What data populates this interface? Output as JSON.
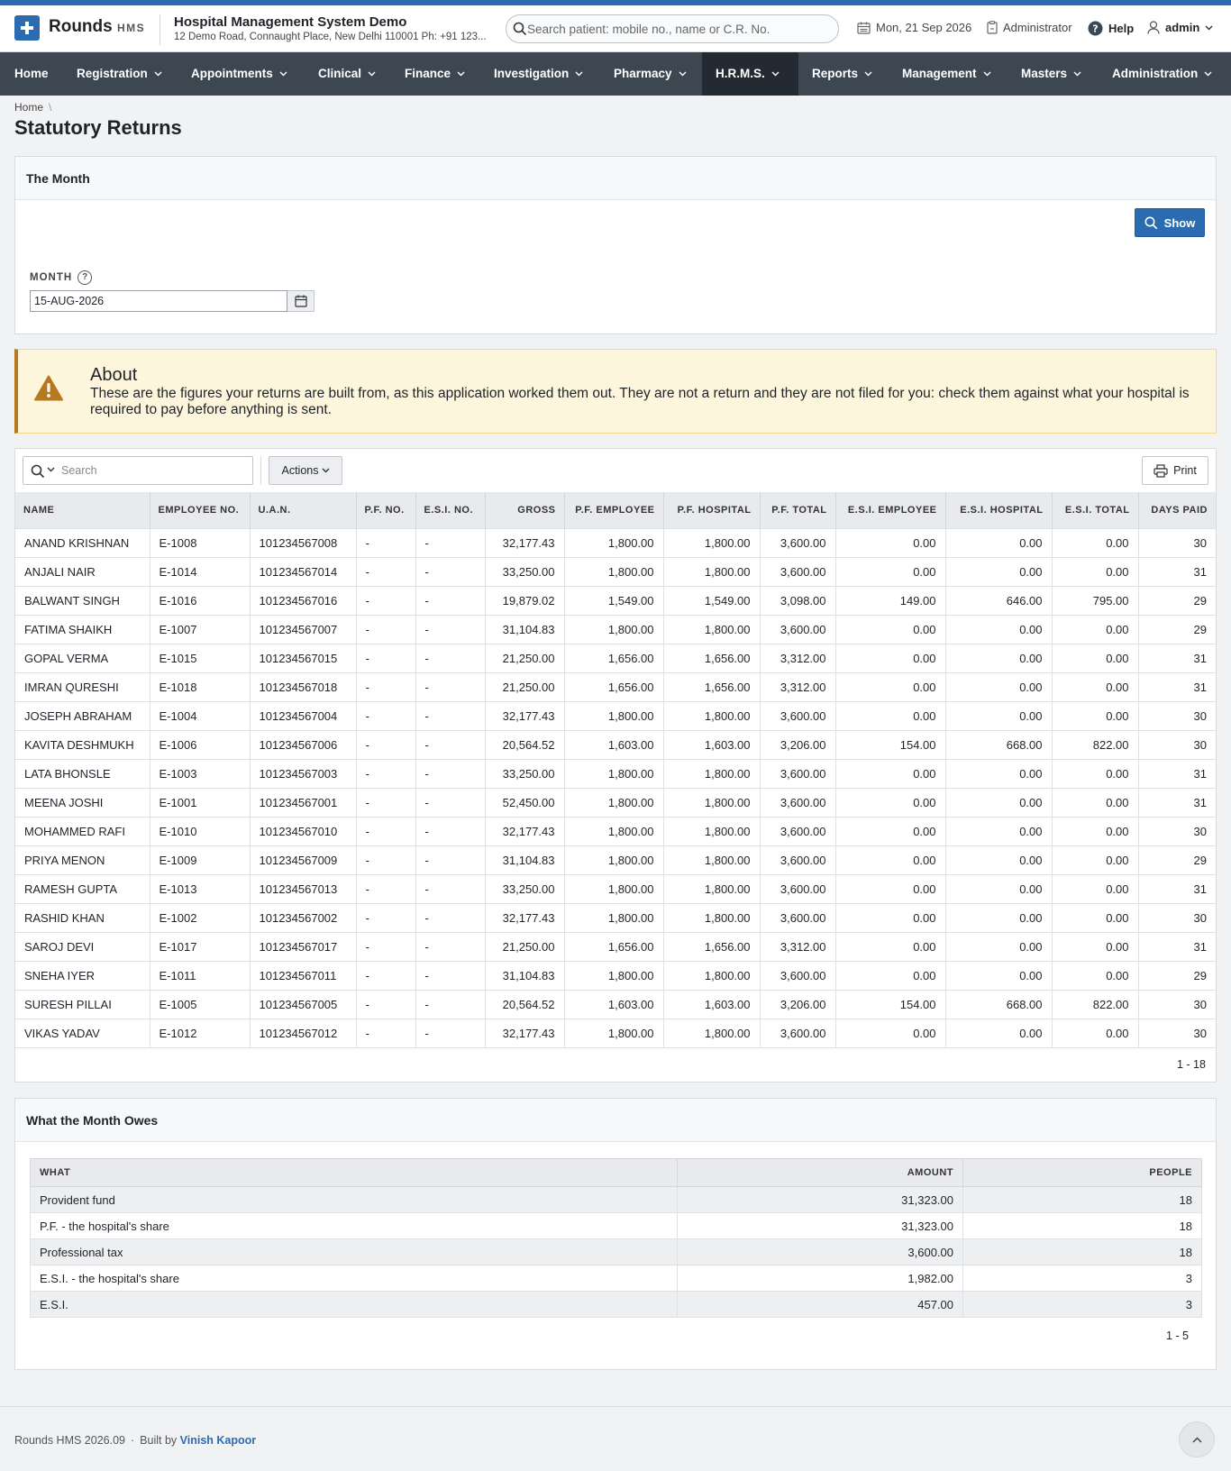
{
  "header": {
    "brand": "Rounds",
    "brand_sub": "HMS",
    "org_name": "Hospital Management System Demo",
    "org_address": "12 Demo Road, Connaught Place, New Delhi 110001 Ph: +91 123...",
    "search_placeholder": "Search patient: mobile no., name or C.R. No.",
    "date": "Mon, 21 Sep 2026",
    "role": "Administrator",
    "help": "Help",
    "user": "admin"
  },
  "nav": [
    {
      "label": "Home",
      "chevron": false
    },
    {
      "label": "Registration",
      "chevron": true
    },
    {
      "label": "Appointments",
      "chevron": true
    },
    {
      "label": "Clinical",
      "chevron": true
    },
    {
      "label": "Finance",
      "chevron": true
    },
    {
      "label": "Investigation",
      "chevron": true
    },
    {
      "label": "Pharmacy",
      "chevron": true
    },
    {
      "label": "H.R.M.S.",
      "chevron": true,
      "active": true
    },
    {
      "label": "Reports",
      "chevron": true
    },
    {
      "label": "Management",
      "chevron": true
    },
    {
      "label": "Masters",
      "chevron": true
    },
    {
      "label": "Administration",
      "chevron": true
    }
  ],
  "breadcrumb": {
    "home": "Home",
    "separator": "\\"
  },
  "page_title": "Statutory Returns",
  "month_panel": {
    "title": "The Month",
    "show_button": "Show",
    "month_label": "MONTH",
    "help_glyph": "?",
    "month_value": "15-AUG-2026"
  },
  "about": {
    "title": "About",
    "text": "These are the figures your returns are built from, as this application worked them out. They are not a return and they are not filed for you: check them against what your hospital is required to pay before anything is sent."
  },
  "report": {
    "search_placeholder": "Search",
    "actions_label": "Actions",
    "print_label": "Print",
    "columns": [
      "NAME",
      "EMPLOYEE NO.",
      "U.A.N.",
      "P.F. NO.",
      "E.S.I. NO.",
      "GROSS",
      "P.F. EMPLOYEE",
      "P.F. HOSPITAL",
      "P.F. TOTAL",
      "E.S.I. EMPLOYEE",
      "E.S.I. HOSPITAL",
      "E.S.I. TOTAL",
      "DAYS PAID"
    ],
    "rows": [
      [
        "ANAND KRISHNAN",
        "E-1008",
        "101234567008",
        "-",
        "-",
        "32,177.43",
        "1,800.00",
        "1,800.00",
        "3,600.00",
        "0.00",
        "0.00",
        "0.00",
        "30"
      ],
      [
        "ANJALI NAIR",
        "E-1014",
        "101234567014",
        "-",
        "-",
        "33,250.00",
        "1,800.00",
        "1,800.00",
        "3,600.00",
        "0.00",
        "0.00",
        "0.00",
        "31"
      ],
      [
        "BALWANT SINGH",
        "E-1016",
        "101234567016",
        "-",
        "-",
        "19,879.02",
        "1,549.00",
        "1,549.00",
        "3,098.00",
        "149.00",
        "646.00",
        "795.00",
        "29"
      ],
      [
        "FATIMA SHAIKH",
        "E-1007",
        "101234567007",
        "-",
        "-",
        "31,104.83",
        "1,800.00",
        "1,800.00",
        "3,600.00",
        "0.00",
        "0.00",
        "0.00",
        "29"
      ],
      [
        "GOPAL VERMA",
        "E-1015",
        "101234567015",
        "-",
        "-",
        "21,250.00",
        "1,656.00",
        "1,656.00",
        "3,312.00",
        "0.00",
        "0.00",
        "0.00",
        "31"
      ],
      [
        "IMRAN QURESHI",
        "E-1018",
        "101234567018",
        "-",
        "-",
        "21,250.00",
        "1,656.00",
        "1,656.00",
        "3,312.00",
        "0.00",
        "0.00",
        "0.00",
        "31"
      ],
      [
        "JOSEPH ABRAHAM",
        "E-1004",
        "101234567004",
        "-",
        "-",
        "32,177.43",
        "1,800.00",
        "1,800.00",
        "3,600.00",
        "0.00",
        "0.00",
        "0.00",
        "30"
      ],
      [
        "KAVITA DESHMUKH",
        "E-1006",
        "101234567006",
        "-",
        "-",
        "20,564.52",
        "1,603.00",
        "1,603.00",
        "3,206.00",
        "154.00",
        "668.00",
        "822.00",
        "30"
      ],
      [
        "LATA BHONSLE",
        "E-1003",
        "101234567003",
        "-",
        "-",
        "33,250.00",
        "1,800.00",
        "1,800.00",
        "3,600.00",
        "0.00",
        "0.00",
        "0.00",
        "31"
      ],
      [
        "MEENA JOSHI",
        "E-1001",
        "101234567001",
        "-",
        "-",
        "52,450.00",
        "1,800.00",
        "1,800.00",
        "3,600.00",
        "0.00",
        "0.00",
        "0.00",
        "31"
      ],
      [
        "MOHAMMED RAFI",
        "E-1010",
        "101234567010",
        "-",
        "-",
        "32,177.43",
        "1,800.00",
        "1,800.00",
        "3,600.00",
        "0.00",
        "0.00",
        "0.00",
        "30"
      ],
      [
        "PRIYA MENON",
        "E-1009",
        "101234567009",
        "-",
        "-",
        "31,104.83",
        "1,800.00",
        "1,800.00",
        "3,600.00",
        "0.00",
        "0.00",
        "0.00",
        "29"
      ],
      [
        "RAMESH GUPTA",
        "E-1013",
        "101234567013",
        "-",
        "-",
        "33,250.00",
        "1,800.00",
        "1,800.00",
        "3,600.00",
        "0.00",
        "0.00",
        "0.00",
        "31"
      ],
      [
        "RASHID KHAN",
        "E-1002",
        "101234567002",
        "-",
        "-",
        "32,177.43",
        "1,800.00",
        "1,800.00",
        "3,600.00",
        "0.00",
        "0.00",
        "0.00",
        "30"
      ],
      [
        "SAROJ DEVI",
        "E-1017",
        "101234567017",
        "-",
        "-",
        "21,250.00",
        "1,656.00",
        "1,656.00",
        "3,312.00",
        "0.00",
        "0.00",
        "0.00",
        "31"
      ],
      [
        "SNEHA IYER",
        "E-1011",
        "101234567011",
        "-",
        "-",
        "31,104.83",
        "1,800.00",
        "1,800.00",
        "3,600.00",
        "0.00",
        "0.00",
        "0.00",
        "29"
      ],
      [
        "SURESH PILLAI",
        "E-1005",
        "101234567005",
        "-",
        "-",
        "20,564.52",
        "1,603.00",
        "1,603.00",
        "3,206.00",
        "154.00",
        "668.00",
        "822.00",
        "30"
      ],
      [
        "VIKAS YADAV",
        "E-1012",
        "101234567012",
        "-",
        "-",
        "32,177.43",
        "1,800.00",
        "1,800.00",
        "3,600.00",
        "0.00",
        "0.00",
        "0.00",
        "30"
      ]
    ],
    "pagination": "1 - 18"
  },
  "owes": {
    "title": "What the Month Owes",
    "columns": [
      "WHAT",
      "AMOUNT",
      "PEOPLE"
    ],
    "rows": [
      [
        "Provident fund",
        "31,323.00",
        "18"
      ],
      [
        "P.F. - the hospital's share",
        "31,323.00",
        "18"
      ],
      [
        "Professional tax",
        "3,600.00",
        "18"
      ],
      [
        "E.S.I. - the hospital's share",
        "1,982.00",
        "3"
      ],
      [
        "E.S.I.",
        "457.00",
        "3"
      ]
    ],
    "pagination": "1 - 5"
  },
  "footer": {
    "version": "Rounds HMS 2026.09",
    "separator": "·",
    "built_by": "Built by",
    "author": "Vinish Kapoor"
  },
  "colors": {
    "accent": "#2b6cb0",
    "navbar": "#3d4752",
    "nav_active": "#232a31",
    "alert_bg": "#fdf5dc",
    "alert_icon": "#b7791f"
  }
}
